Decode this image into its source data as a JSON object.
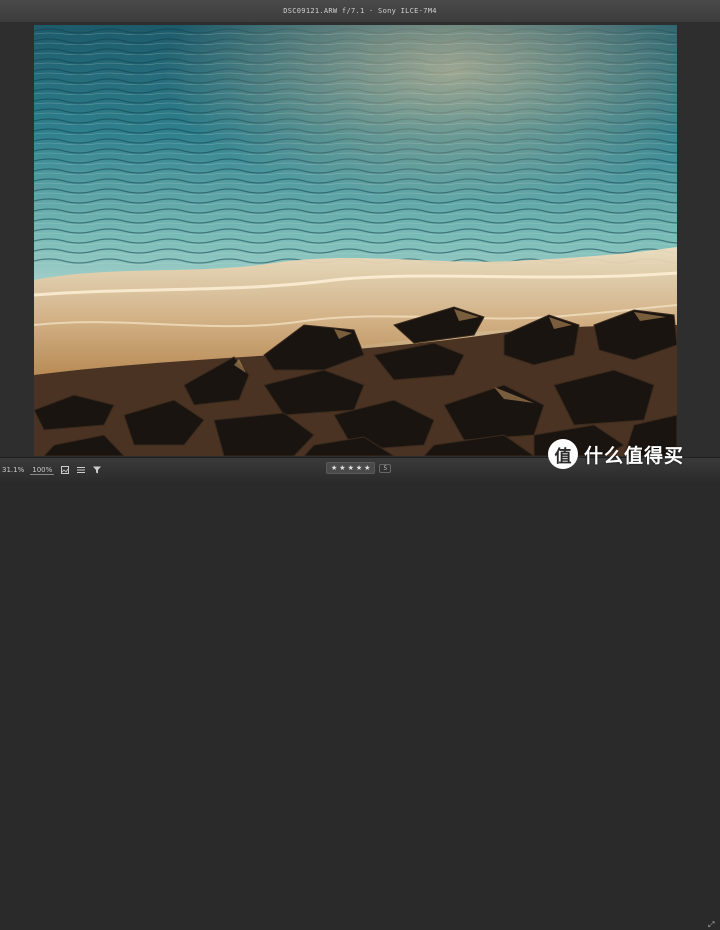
{
  "window": {
    "title": "DSC09121.ARW  f/7.1  ·  Sony ILCE-7M4"
  },
  "toolbar": {
    "zoom_readout": "31.1%",
    "zoom_level": "100%",
    "icons": [
      "image-icon",
      "list-icon",
      "filter-icon"
    ]
  },
  "rating": {
    "stars": [
      "★",
      "★",
      "★",
      "★",
      "★"
    ],
    "value": "5"
  },
  "watermark": {
    "logo_glyph": "值",
    "text": "什么值得买"
  },
  "colors": {
    "sea_top": "#1f5f6e",
    "sea_mid": "#6fb3b0",
    "sunlit_foam": "#e8c9a0",
    "rocks": "#1a1410"
  }
}
